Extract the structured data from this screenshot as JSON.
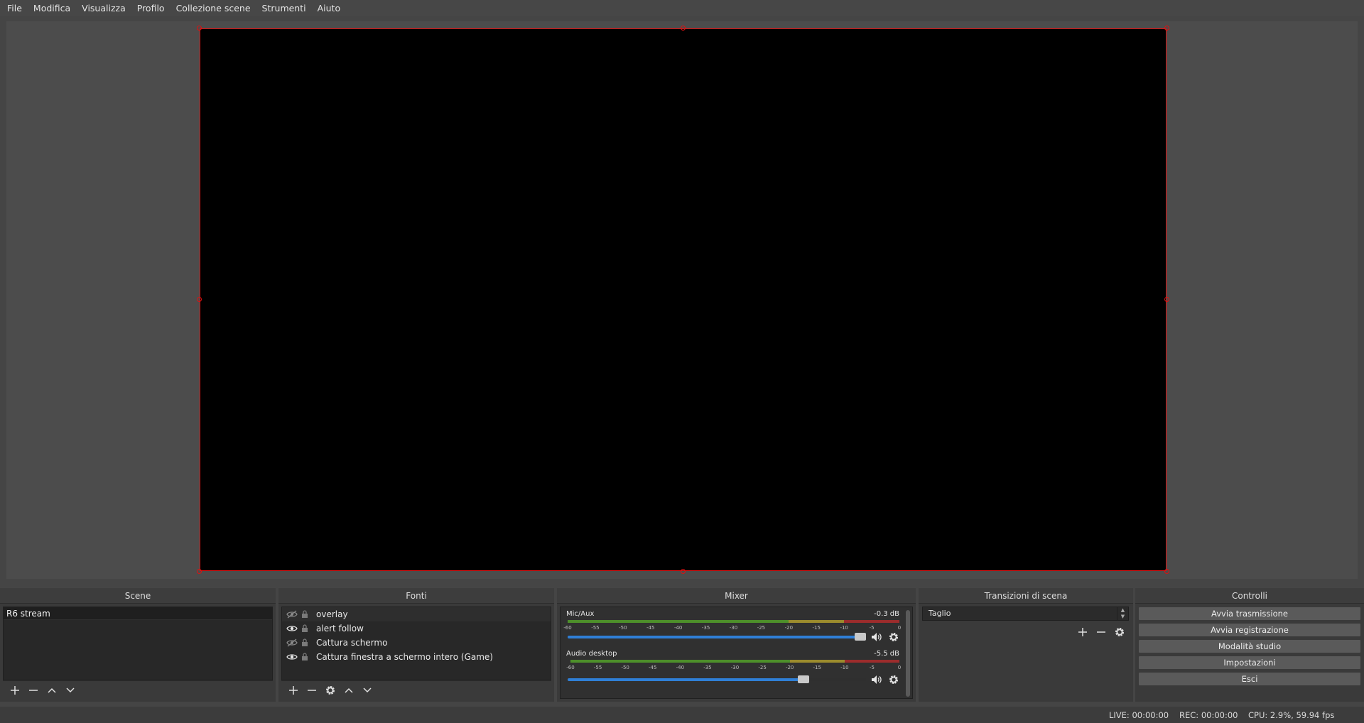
{
  "menubar": {
    "items": [
      "File",
      "Modifica",
      "Visualizza",
      "Profilo",
      "Collezione scene",
      "Strumenti",
      "Aiuto"
    ]
  },
  "docks": {
    "scenes_title": "Scene",
    "sources_title": "Fonti",
    "mixer_title": "Mixer",
    "transitions_title": "Transizioni di scena",
    "controls_title": "Controlli"
  },
  "scenes": {
    "items": [
      "R6 stream"
    ]
  },
  "sources": {
    "items": [
      {
        "label": "overlay",
        "visible": false
      },
      {
        "label": "alert follow",
        "visible": true
      },
      {
        "label": "Cattura schermo",
        "visible": false
      },
      {
        "label": "Cattura finestra a schermo intero (Game)",
        "visible": true
      }
    ]
  },
  "mixer": {
    "tick_labels": [
      "-60",
      "-55",
      "-50",
      "-45",
      "-40",
      "-35",
      "-30",
      "-25",
      "-20",
      "-15",
      "-10",
      "-5",
      "0"
    ],
    "channels": [
      {
        "name": "Mic/Aux",
        "db": "-0.3 dB",
        "volume_fraction": 0.98
      },
      {
        "name": "Audio desktop",
        "db": "-5.5 dB",
        "volume_fraction": 0.79
      }
    ]
  },
  "transitions": {
    "selected": "Taglio"
  },
  "controls": {
    "buttons": [
      "Avvia trasmissione",
      "Avvia registrazione",
      "Modalità studio",
      "Impostazioni",
      "Esci"
    ]
  },
  "status": {
    "live": "LIVE: 00:00:00",
    "rec": "REC: 00:00:00",
    "cpu": "CPU: 2.9%, 59.94 fps"
  },
  "colors": {
    "selection_border": "#e01010",
    "volume_fill": "#2f7fd6",
    "meter_green": "#4d8f2a",
    "meter_yellow": "#9b8b2d",
    "meter_red": "#9c2c2c"
  },
  "icons": {
    "add": "plus-icon",
    "remove": "minus-icon",
    "up": "chevron-up-icon",
    "down": "chevron-down-icon",
    "settings": "gear-icon",
    "visibility": "eye-icon",
    "lock": "lock-icon",
    "volume": "speaker-icon"
  }
}
